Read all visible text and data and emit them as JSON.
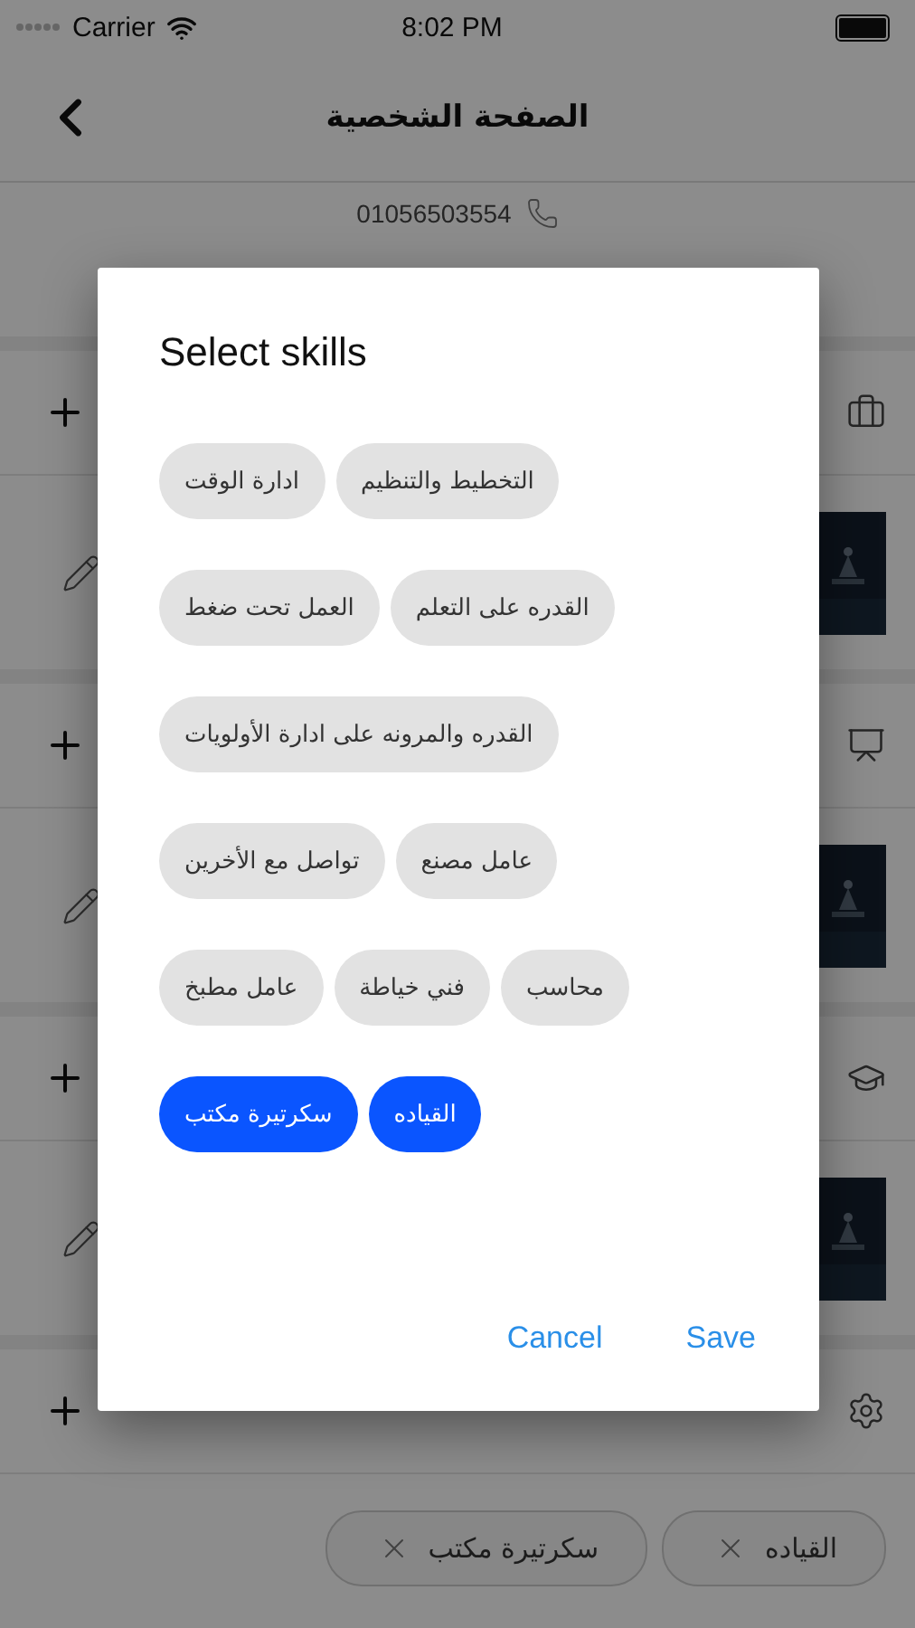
{
  "status_bar": {
    "carrier": "Carrier",
    "time": "8:02 PM"
  },
  "nav": {
    "title": "الصفحة الشخصية"
  },
  "profile": {
    "phone": "01056503554"
  },
  "sections": [
    {
      "kind": "picture"
    },
    {
      "kind": "picture"
    },
    {
      "kind": "picture"
    },
    {
      "kind": "tags",
      "tags": [
        {
          "label": "القياده"
        },
        {
          "label": "سكرتيرة مكتب"
        }
      ]
    }
  ],
  "dialog": {
    "title": "Select skills",
    "skill_rows": [
      [
        {
          "label": "التخطيط والتنظيم",
          "selected": false
        },
        {
          "label": "ادارة الوقت",
          "selected": false
        }
      ],
      [
        {
          "label": "القدره على التعلم",
          "selected": false
        },
        {
          "label": "العمل تحت ضغط",
          "selected": false
        }
      ],
      [
        {
          "label": "القدره والمرونه على ادارة الأولويات",
          "selected": false
        }
      ],
      [
        {
          "label": "عامل مصنع",
          "selected": false
        },
        {
          "label": "تواصل مع الأخرين",
          "selected": false
        }
      ],
      [
        {
          "label": "محاسب",
          "selected": false
        },
        {
          "label": "فني خياطة",
          "selected": false
        },
        {
          "label": "عامل مطبخ",
          "selected": false
        }
      ],
      [
        {
          "label": "القياده",
          "selected": true
        },
        {
          "label": "سكرتيرة مكتب",
          "selected": true
        }
      ]
    ],
    "cancel_button": {
      "label": "Cancel"
    },
    "save_button": {
      "label": "Save"
    }
  }
}
